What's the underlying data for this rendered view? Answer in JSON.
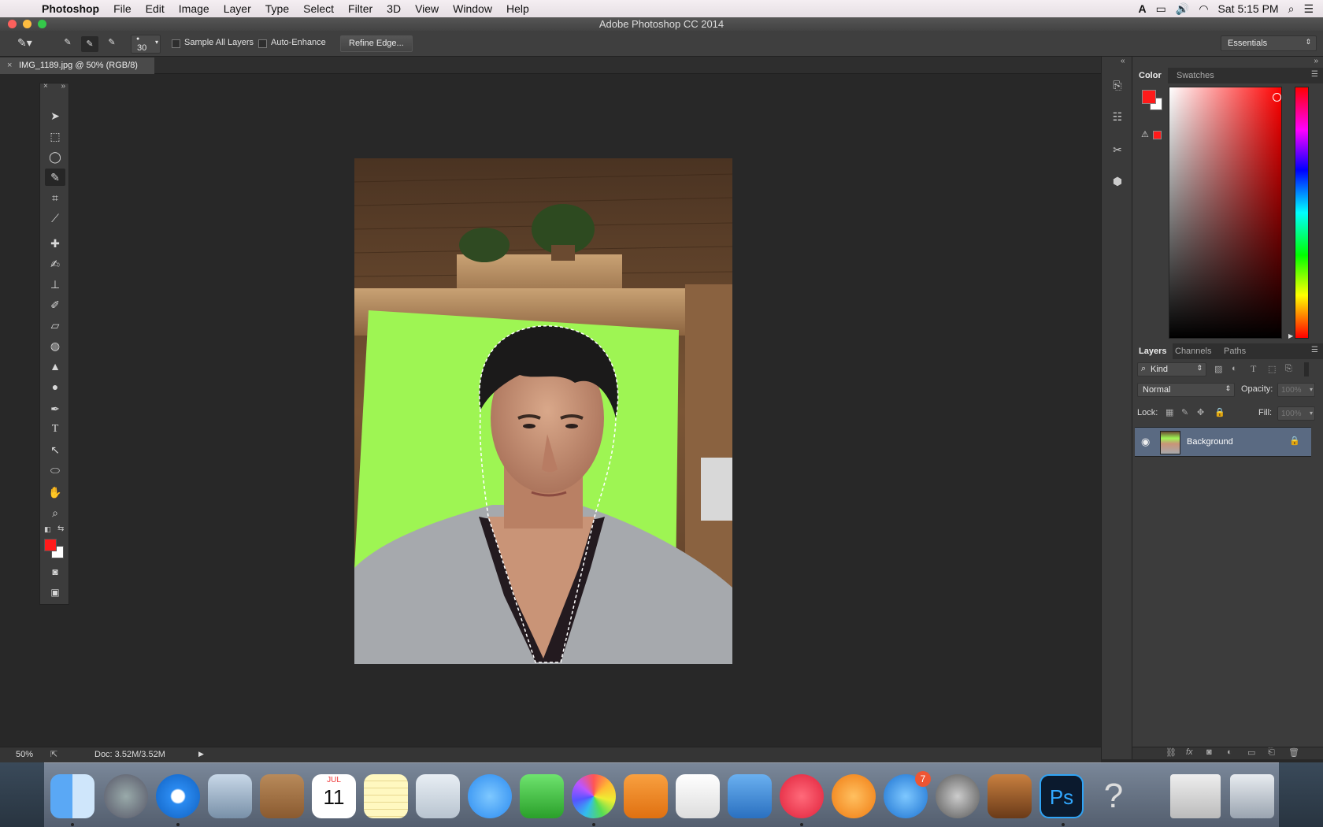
{
  "menubar": {
    "items": [
      "Photoshop",
      "File",
      "Edit",
      "Image",
      "Layer",
      "Type",
      "Select",
      "Filter",
      "3D",
      "View",
      "Window",
      "Help"
    ],
    "clock": "Sat 5:15 PM"
  },
  "window": {
    "title": "Adobe Photoshop CC 2014"
  },
  "options": {
    "brush_size": "30",
    "sample_all_layers": "Sample All Layers",
    "auto_enhance": "Auto-Enhance",
    "refine_edge": "Refine Edge...",
    "workspace": "Essentials"
  },
  "document": {
    "tab_title": "IMG_1189.jpg @ 50% (RGB/8)"
  },
  "colors": {
    "foreground": "#ff1a1a",
    "background": "#ffffff",
    "accent_layer": "#5a6a82"
  },
  "color_panel": {
    "tabs": [
      "Color",
      "Swatches"
    ]
  },
  "layers_panel": {
    "tabs": [
      "Layers",
      "Channels",
      "Paths"
    ],
    "filter": "Kind",
    "blend_mode": "Normal",
    "opacity_label": "Opacity:",
    "opacity_value": "100%",
    "lock_label": "Lock:",
    "fill_label": "Fill:",
    "fill_value": "100%",
    "layers": [
      {
        "name": "Background"
      }
    ]
  },
  "status": {
    "zoom": "50%",
    "doc": "Doc: 3.52M/3.52M"
  },
  "dock": {
    "calendar_month": "JUL",
    "calendar_day": "11",
    "appstore_badge": "7",
    "photoshop_label": "Ps"
  }
}
